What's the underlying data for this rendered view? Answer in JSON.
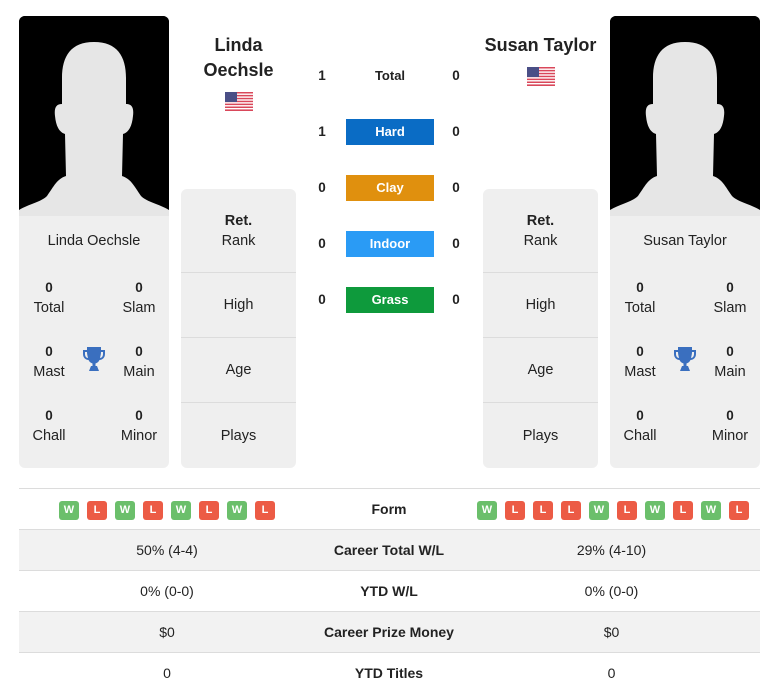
{
  "colors": {
    "hard": "#0a6cc5",
    "clay": "#e0900e",
    "indoor": "#2a9bf5",
    "grass": "#0e9a3c",
    "win": "#6bbf6b",
    "loss": "#ec5b45",
    "trophy": "#3a6fbf"
  },
  "player1": {
    "name_line1": "Linda",
    "name_line2": "Oechsle",
    "card_name": "Linda Oechsle",
    "flag": "us-flag",
    "titles": {
      "total": {
        "value": "0",
        "label": "Total"
      },
      "slam": {
        "value": "0",
        "label": "Slam"
      },
      "mast": {
        "value": "0",
        "label": "Mast"
      },
      "main": {
        "value": "0",
        "label": "Main"
      },
      "chall": {
        "value": "0",
        "label": "Chall"
      },
      "minor": {
        "value": "0",
        "label": "Minor"
      }
    },
    "info": {
      "rank_line1": "Ret.",
      "rank_line2": "Rank",
      "high": "High",
      "age": "Age",
      "plays": "Plays"
    },
    "form": [
      "W",
      "L",
      "W",
      "L",
      "W",
      "L",
      "W",
      "L"
    ]
  },
  "player2": {
    "name": "Susan Taylor",
    "card_name": "Susan Taylor",
    "flag": "us-flag",
    "titles": {
      "total": {
        "value": "0",
        "label": "Total"
      },
      "slam": {
        "value": "0",
        "label": "Slam"
      },
      "mast": {
        "value": "0",
        "label": "Mast"
      },
      "main": {
        "value": "0",
        "label": "Main"
      },
      "chall": {
        "value": "0",
        "label": "Chall"
      },
      "minor": {
        "value": "0",
        "label": "Minor"
      }
    },
    "info": {
      "rank_line1": "Ret.",
      "rank_line2": "Rank",
      "high": "High",
      "age": "Age",
      "plays": "Plays"
    },
    "form": [
      "W",
      "L",
      "L",
      "L",
      "W",
      "L",
      "W",
      "L",
      "W",
      "L"
    ]
  },
  "h2h": [
    {
      "label": "Total",
      "p1": "1",
      "p2": "0",
      "type": "total"
    },
    {
      "label": "Hard",
      "p1": "1",
      "p2": "0",
      "type": "hard"
    },
    {
      "label": "Clay",
      "p1": "0",
      "p2": "0",
      "type": "clay"
    },
    {
      "label": "Indoor",
      "p1": "0",
      "p2": "0",
      "type": "indoor"
    },
    {
      "label": "Grass",
      "p1": "0",
      "p2": "0",
      "type": "grass"
    }
  ],
  "stats": {
    "form_label": "Form",
    "rows": [
      {
        "label": "Career Total W/L",
        "p1": "50% (4-4)",
        "p2": "29% (4-10)"
      },
      {
        "label": "YTD W/L",
        "p1": "0% (0-0)",
        "p2": "0% (0-0)"
      },
      {
        "label": "Career Prize Money",
        "p1": "$0",
        "p2": "$0"
      },
      {
        "label": "YTD Titles",
        "p1": "0",
        "p2": "0"
      }
    ]
  }
}
